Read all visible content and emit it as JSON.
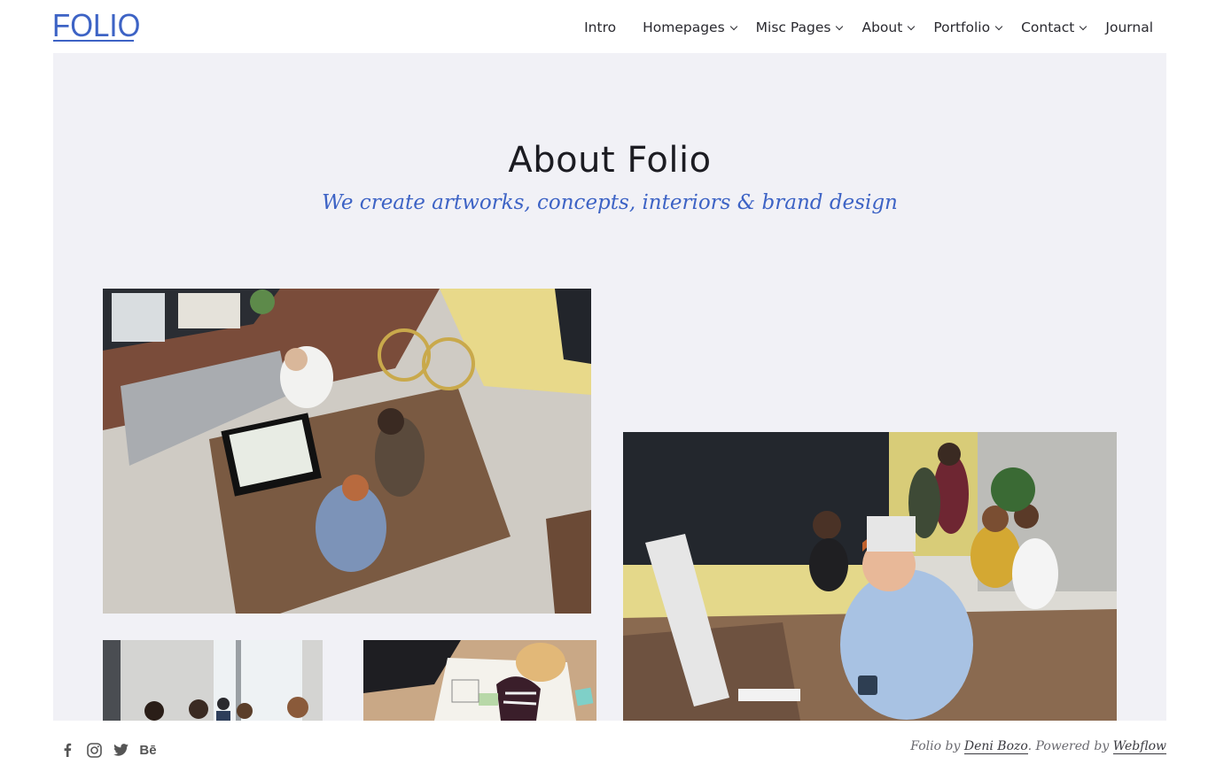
{
  "brand": {
    "logo_text": "FOLIO",
    "accent_color": "#3d63c5"
  },
  "nav": {
    "items": [
      {
        "label": "Intro",
        "dropdown": false
      },
      {
        "label": "Homepages",
        "dropdown": true
      },
      {
        "label": "Misc Pages",
        "dropdown": true
      },
      {
        "label": "About",
        "dropdown": true
      },
      {
        "label": "Portfolio",
        "dropdown": true
      },
      {
        "label": "Contact",
        "dropdown": true
      },
      {
        "label": "Journal",
        "dropdown": false
      }
    ]
  },
  "hero": {
    "title": "About Folio",
    "subtitle": "We create artworks, concepts, interiors & brand design"
  },
  "gallery": {
    "images": [
      {
        "name": "office-meeting-photo",
        "subject": "people working at a wooden table with an iMac and a yellow bicycle"
      },
      {
        "name": "team-workspace-photo",
        "subject": "young man at a desk with an iMac, team in background"
      },
      {
        "name": "group-discussion-photo",
        "subject": "group of people in a bright room"
      },
      {
        "name": "sketching-photo",
        "subject": "people sketching on paper at a table"
      }
    ]
  },
  "back_to_top": {
    "icon": "arrow-up-icon"
  },
  "footer": {
    "socials": [
      {
        "icon": "facebook-icon"
      },
      {
        "icon": "instagram-icon"
      },
      {
        "icon": "twitter-icon"
      },
      {
        "icon": "behance-icon",
        "text": "Bē"
      }
    ],
    "credits": {
      "prefix": "Folio by ",
      "author": "Deni Bozo",
      "middle": ". Powered by ",
      "platform": "Webflow"
    }
  }
}
